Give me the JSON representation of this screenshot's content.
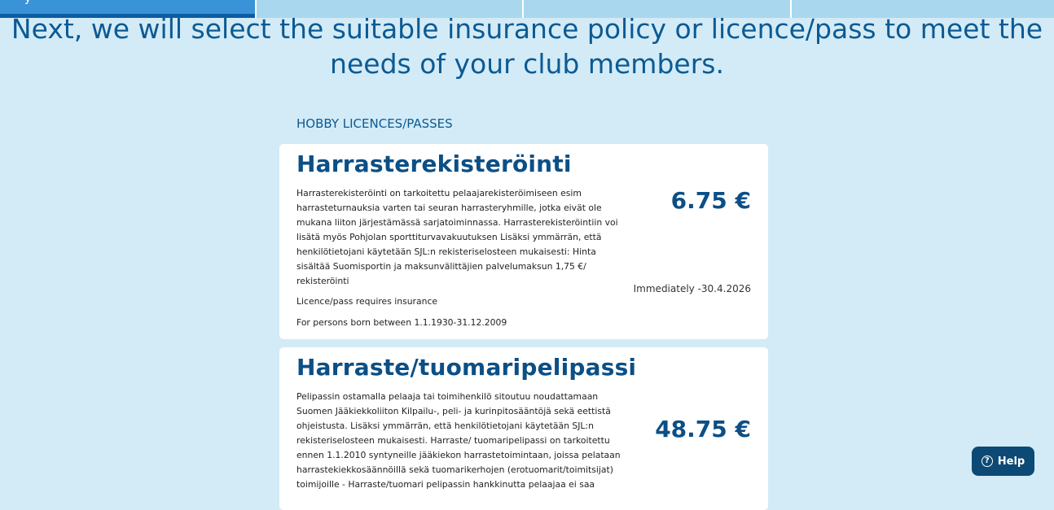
{
  "progress": {
    "steps": [
      {
        "label": "y",
        "active": true
      },
      {
        "label": "",
        "active": false
      },
      {
        "label": "",
        "active": false
      },
      {
        "label": "",
        "active": false
      }
    ]
  },
  "headline": "Next, we will select the suitable insurance policy or licence/pass to meet the needs of your club members.",
  "section_title": "HOBBY LICENCES/PASSES",
  "cards": [
    {
      "title": "Harrasterekisteröinti",
      "description": "Harrasterekisteröinti on tarkoitettu pelaajarekisteröimiseen esim harrasteturnauksia varten tai seuran harrasteryhmille, jotka eivät ole mukana liiton järjestämässä sarjatoiminnassa. Harrasterekisteröintiin voi lisätä myös Pohjolan sporttiturvavakuutuksen Lisäksi ymmärrän, että henkilötietojani käytetään SJL:n rekisteriselosteen mukaisesti: Hinta sisältää Suomisportin ja maksunvälittäjien palvelumaksun 1,75 €/ rekisteröinti",
      "price": "6.75 €",
      "validity": "Immediately -30.4.2026",
      "note1": "Licence/pass requires insurance",
      "note2": "For persons born between 1.1.1930-31.12.2009"
    },
    {
      "title": "Harraste/tuomaripelipassi",
      "description": "Pelipassin ostamalla pelaaja tai toimihenkilö sitoutuu noudattamaan Suomen Jääkiekkoliiton Kilpailu-, peli- ja kurinpitosääntöjä sekä eettistä ohjeistusta. Lisäksi ymmärrän, että henkilötietojani käytetään SJL:n rekisteriselosteen mukaisesti. Harraste/ tuomaripelipassi on tarkoitettu ennen 1.1.2010 syntyneille jääkiekon harrastetoimintaan, joissa pelataan harrastekiekkosäännöillä sekä tuomarikerhojen (erotuomarit/toimitsijat) toimijoille - Harraste/tuomari pelipassin hankkinutta pelaajaa ei saa",
      "price": "48.75 €"
    }
  ],
  "help": {
    "label": "Help",
    "icon": "question-circle-icon"
  }
}
